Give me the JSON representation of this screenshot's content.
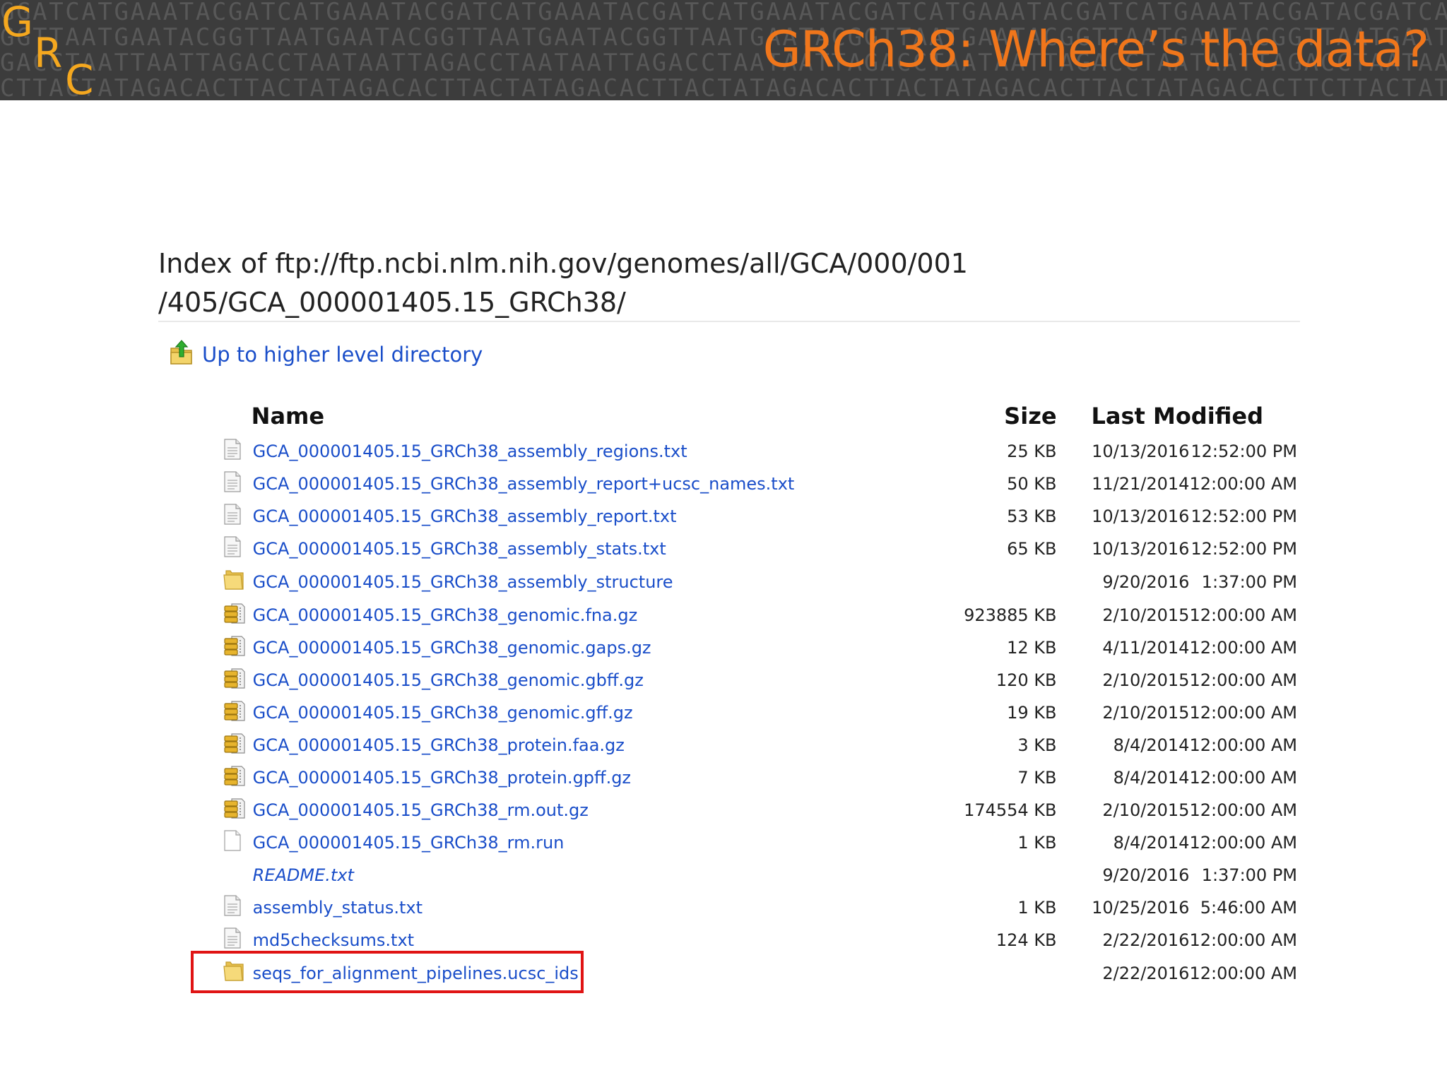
{
  "banner": {
    "dna_lines": [
      "GGATCATGAAATACGATCATGAAATACGATCATGAAATACGATCATGAAATACGATCATGAAATACGATCATGAAATACGATACGATCATGAAA",
      "GGTTAATGAATACGGTTAATGAATACGGTTAATGAATACGGTTAATGAATACGGTTAATGAATACGGTTAATGAATACGGTTAATGAATACGG",
      "GACCTAATTAATTAGACCTAATAATTAGACCTAATAATTAGACCTAATAATTAGACCTAATAATTAGACCTAATAATTAGACCTAATAATTAG",
      "CTTACTATAGACACTTACTATAGACACTTACTATAGACACTTACTATAGACACTTACTATAGACACTTACTATAGACACTTCTTACTATAGACA"
    ],
    "logo": {
      "g": "G",
      "r": "R",
      "c": "C"
    },
    "title": "GRCh38: Where’s the data?"
  },
  "index": {
    "title_line1": "Index of ftp://ftp.ncbi.nlm.nih.gov/genomes/all/GCA/000/001",
    "title_line2": "/405/GCA_000001405.15_GRCh38/",
    "up_link": "Up to higher level directory"
  },
  "table": {
    "headers": {
      "name": "Name",
      "size": "Size",
      "modified": "Last Modified"
    },
    "rows": [
      {
        "icon": "text-file-icon",
        "name": "GCA_000001405.15_GRCh38_assembly_regions.txt",
        "size": "25 KB",
        "date": "10/13/2016",
        "time": "12:52:00 PM"
      },
      {
        "icon": "text-file-icon",
        "name": "GCA_000001405.15_GRCh38_assembly_report+ucsc_names.txt",
        "size": "50 KB",
        "date": "11/21/2014",
        "time": "12:00:00 AM"
      },
      {
        "icon": "text-file-icon",
        "name": "GCA_000001405.15_GRCh38_assembly_report.txt",
        "size": "53 KB",
        "date": "10/13/2016",
        "time": "12:52:00 PM"
      },
      {
        "icon": "text-file-icon",
        "name": "GCA_000001405.15_GRCh38_assembly_stats.txt",
        "size": "65 KB",
        "date": "10/13/2016",
        "time": "12:52:00 PM"
      },
      {
        "icon": "folder-icon",
        "name": "GCA_000001405.15_GRCh38_assembly_structure",
        "size": "",
        "date": "9/20/2016",
        "time": "1:37:00 PM"
      },
      {
        "icon": "archive-icon",
        "name": "GCA_000001405.15_GRCh38_genomic.fna.gz",
        "size": "923885 KB",
        "date": "2/10/2015",
        "time": "12:00:00 AM"
      },
      {
        "icon": "archive-icon",
        "name": "GCA_000001405.15_GRCh38_genomic.gaps.gz",
        "size": "12 KB",
        "date": "4/11/2014",
        "time": "12:00:00 AM"
      },
      {
        "icon": "archive-icon",
        "name": "GCA_000001405.15_GRCh38_genomic.gbff.gz",
        "size": "120 KB",
        "date": "2/10/2015",
        "time": "12:00:00 AM"
      },
      {
        "icon": "archive-icon",
        "name": "GCA_000001405.15_GRCh38_genomic.gff.gz",
        "size": "19 KB",
        "date": "2/10/2015",
        "time": "12:00:00 AM"
      },
      {
        "icon": "archive-icon",
        "name": "GCA_000001405.15_GRCh38_protein.faa.gz",
        "size": "3 KB",
        "date": "8/4/2014",
        "time": "12:00:00 AM"
      },
      {
        "icon": "archive-icon",
        "name": "GCA_000001405.15_GRCh38_protein.gpff.gz",
        "size": "7 KB",
        "date": "8/4/2014",
        "time": "12:00:00 AM"
      },
      {
        "icon": "archive-icon",
        "name": "GCA_000001405.15_GRCh38_rm.out.gz",
        "size": "174554 KB",
        "date": "2/10/2015",
        "time": "12:00:00 AM"
      },
      {
        "icon": "blank-file-icon",
        "name": "GCA_000001405.15_GRCh38_rm.run",
        "size": "1 KB",
        "date": "8/4/2014",
        "time": "12:00:00 AM"
      },
      {
        "icon": "none",
        "name": "README.txt",
        "size": "",
        "date": "9/20/2016",
        "time": "1:37:00 PM"
      },
      {
        "icon": "text-file-icon",
        "name": "assembly_status.txt",
        "size": "1 KB",
        "date": "10/25/2016",
        "time": "5:46:00 AM"
      },
      {
        "icon": "text-file-icon",
        "name": "md5checksums.txt",
        "size": "124 KB",
        "date": "2/22/2016",
        "time": "12:00:00 AM"
      },
      {
        "icon": "folder-icon",
        "name": "seqs_for_alignment_pipelines.ucsc_ids",
        "size": "",
        "date": "2/22/2016",
        "time": "12:00:00 AM"
      }
    ]
  },
  "colors": {
    "banner_bg": "#3c3c3c",
    "title_orange": "#f0761b",
    "logo_gold": "#f5a81f",
    "link_blue": "#1a4ec9",
    "highlight_red": "#e01414"
  }
}
